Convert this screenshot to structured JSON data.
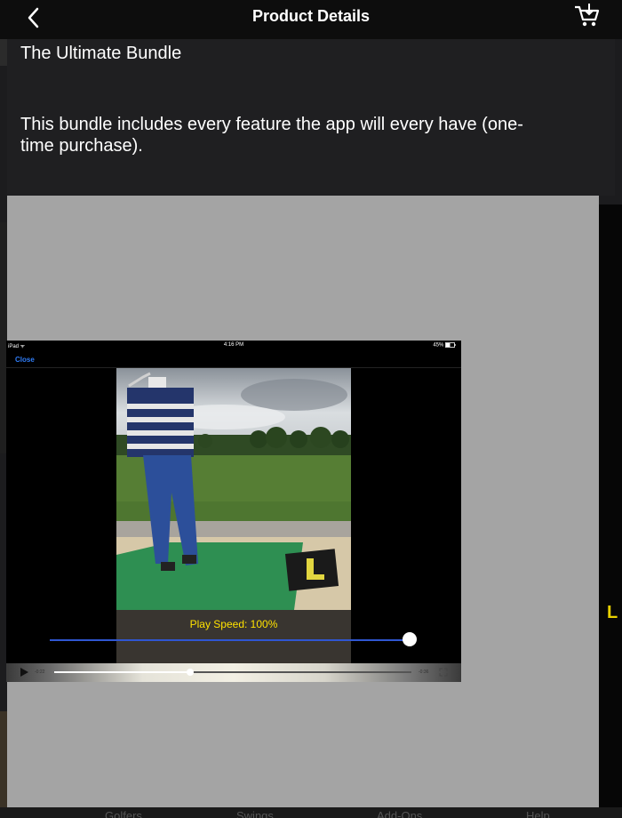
{
  "nav": {
    "title": "Product Details"
  },
  "product": {
    "title": "The Ultimate Bundle",
    "description": "This bundle includes every feature the app will every have (one-time purchase)."
  },
  "preview": {
    "status_left": "iPad ᯤ",
    "status_time": "4:16 PM",
    "status_battery": "45%",
    "close_label": "Close",
    "play_speed": "Play Speed: 100%",
    "time_elapsed": "-0:22",
    "time_remaining": "-0:36",
    "playback_progress": 0.38
  },
  "tabs": [
    {
      "label": "Golfers"
    },
    {
      "label": "Swings"
    },
    {
      "label": "Add-Ons"
    },
    {
      "label": "Help"
    }
  ],
  "side_badge": "L",
  "colors": {
    "nav_bg": "#0d0d0d",
    "panel_bg": "#1f1f21",
    "preview_bg": "#a4a4a4",
    "speed_text": "#ffe200",
    "slider_track": "#2f56d1",
    "link": "#2f7cf6"
  }
}
